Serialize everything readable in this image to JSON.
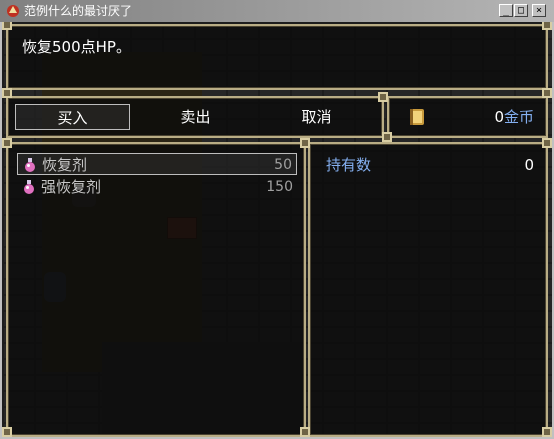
{
  "window": {
    "title": "范例什么的最讨厌了",
    "min_label": "_",
    "max_label": "□",
    "close_label": "×"
  },
  "help": {
    "text": "恢复500点HP。"
  },
  "commands": [
    {
      "label": "买入",
      "selected": true
    },
    {
      "label": "卖出",
      "selected": false
    },
    {
      "label": "取消",
      "selected": false
    }
  ],
  "gold": {
    "amount": "0",
    "unit": "金币",
    "icon": "gold-book-icon"
  },
  "items": [
    {
      "name": "恢复剂",
      "price": "50",
      "icon": "potion-icon",
      "selected": true
    },
    {
      "name": "强恢复剂",
      "price": "150",
      "icon": "potion-icon",
      "selected": false
    }
  ],
  "status": {
    "possession_label": "持有数",
    "possession_value": "0"
  },
  "colors": {
    "system_blue": "#84aff0",
    "frame": "#b9ad85"
  }
}
